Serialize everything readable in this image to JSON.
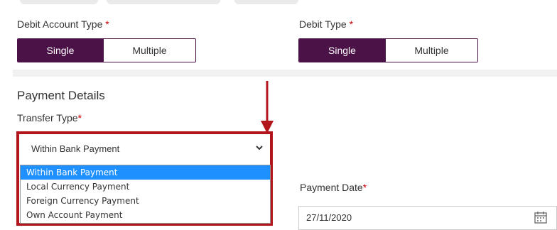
{
  "debit_account_type": {
    "label": "Debit Account Type",
    "required_mark": "*",
    "options": [
      "Single",
      "Multiple"
    ],
    "selected": "Single"
  },
  "debit_type": {
    "label": "Debit Type",
    "required_mark": "*",
    "options": [
      "Single",
      "Multiple"
    ],
    "selected": "Single"
  },
  "payment_details": {
    "title": "Payment Details",
    "transfer_type": {
      "label": "Transfer Type",
      "required_mark": "*",
      "value": "Within Bank Payment",
      "options": [
        "Within Bank Payment",
        "Local Currency Payment",
        "Foreign Currency Payment",
        "Own Account Payment"
      ],
      "highlighted_option": "Within Bank Payment"
    },
    "payment_date": {
      "label": "Payment Date",
      "required_mark": "*",
      "value": "27/11/2020"
    }
  },
  "colors": {
    "brand_purple": "#4b1248",
    "annotation_red": "#b3151c",
    "dropdown_highlight": "#1e90ff",
    "required_red": "#cc0000"
  },
  "icons": [
    "chevron-down-icon",
    "calendar-icon",
    "annotation-arrow"
  ]
}
